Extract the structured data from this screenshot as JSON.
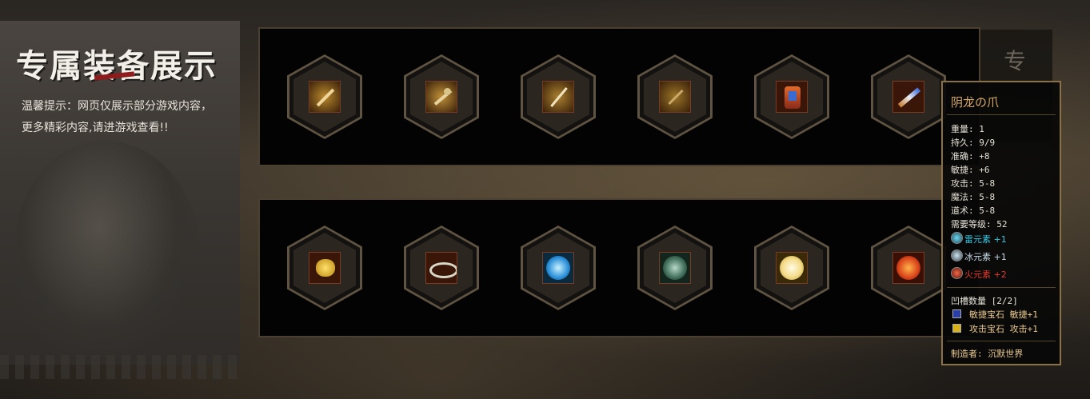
{
  "side": {
    "title": "专属装备展示",
    "tip_line1": "温馨提示：网页仅展示部分游戏内容，",
    "tip_line2": "更多精彩内容,请进游戏查看!!"
  },
  "deco_text": "专",
  "row1": [
    {
      "name": "weapon-icon-1"
    },
    {
      "name": "weapon-icon-2"
    },
    {
      "name": "weapon-icon-3"
    },
    {
      "name": "weapon-icon-4"
    },
    {
      "name": "armor-icon"
    },
    {
      "name": "claw-icon"
    }
  ],
  "row2": [
    {
      "name": "golden-beast-icon"
    },
    {
      "name": "silver-crown-icon"
    },
    {
      "name": "ice-orb-icon"
    },
    {
      "name": "thunder-rune-icon"
    },
    {
      "name": "sun-orb-icon"
    },
    {
      "name": "fire-orb-icon"
    }
  ],
  "tooltip": {
    "title": "阴龙の爪",
    "stats": [
      "重量: 1",
      "持久: 9/9",
      "准确: +8",
      "敏捷: +6",
      "攻击: 5-8",
      "魔法: 5-8",
      "道术: 5-8",
      "需要等级: 52"
    ],
    "elements": [
      {
        "text": "雷元素 +1",
        "color": "#37c6e2"
      },
      {
        "text": "冰元素 +1",
        "color": "#c8dce8"
      },
      {
        "text": "火元素 +2",
        "color": "#e23b2f"
      }
    ],
    "socket_header": "凹槽数量 [2/2]",
    "gems": [
      {
        "text": "敏捷宝石 敏捷+1"
      },
      {
        "text": "攻击宝石 攻击+1"
      }
    ],
    "maker": "制造者: 沉默世界"
  },
  "colors": {
    "title_gold": "#d7a968",
    "frame_gold": "#8b7244",
    "thunder": "#37c6e2",
    "ice": "#c8dce8",
    "fire": "#e23b2f"
  }
}
